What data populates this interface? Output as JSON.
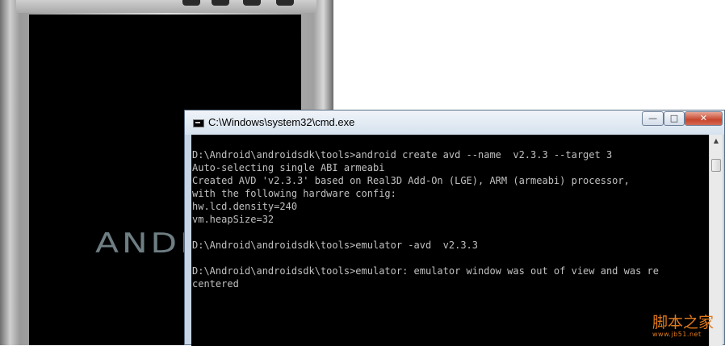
{
  "emulator": {
    "boot_logo_text": "ANDR"
  },
  "cmd_window": {
    "title": "C:\\Windows\\system32\\cmd.exe",
    "buttons": {
      "minimize": "—",
      "maximize": "□",
      "close": "✕"
    },
    "console_lines": [
      "D:\\Android\\androidsdk\\tools>android create avd --name  v2.3.3 --target 3",
      "Auto-selecting single ABI armeabi",
      "Created AVD 'v2.3.3' based on Real3D Add-On (LGE), ARM (armeabi) processor,",
      "with the following hardware config:",
      "hw.lcd.density=240",
      "vm.heapSize=32",
      "",
      "D:\\Android\\androidsdk\\tools>emulator -avd  v2.3.3",
      "",
      "D:\\Android\\androidsdk\\tools>emulator: emulator window was out of view and was re",
      "centered"
    ],
    "scrollbar": {
      "up_arrow": "▲",
      "down_arrow": "▼"
    }
  },
  "watermark": {
    "text": "脚本之家",
    "url": "www.jb51.net"
  },
  "colors": {
    "console_bg": "#000000",
    "console_text": "#c0c0c0",
    "watermark": "#e07a1c"
  }
}
